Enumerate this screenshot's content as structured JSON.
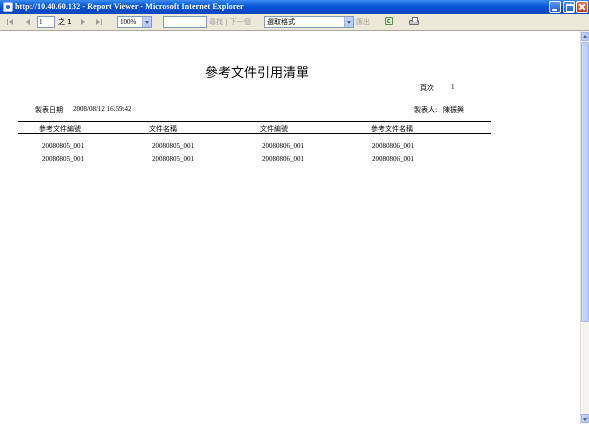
{
  "window": {
    "title": "http://10.40.60.132 - Report Viewer - Microsoft Internet Explorer"
  },
  "toolbar": {
    "page_number": "1",
    "of_total": "之 1",
    "zoom": "100%",
    "find_input_value": "",
    "find_links": "尋找 | 下一個",
    "export_format": "選取格式",
    "export_label": "匯出"
  },
  "report": {
    "title": "參考文件引用清單",
    "page_label": "頁次",
    "page_number": "1",
    "print_date_label": "製表日期",
    "print_date_value": "2008/08/12 16:59:42",
    "creator_label": "製表人:",
    "creator_value": "陳振興",
    "columns": [
      "參考文件編號",
      "文件名稱",
      "文件編號",
      "參考文件名稱"
    ],
    "rows": [
      [
        "20080805_001",
        "20080805_001",
        "20080806_001",
        "20080806_001"
      ],
      [
        "20080805_001",
        "20080805_001",
        "20080806_001",
        "20080806_001"
      ]
    ]
  },
  "colors": {
    "titlebar": "#0A5BD8",
    "toolbar_bg": "#ECE9D8",
    "report_bg": "#FFFFFF",
    "disabled_text": "#A0A0A0"
  },
  "icons": {
    "first_page": "first-page-icon",
    "prev_page": "prev-page-icon",
    "next_page": "next-page-icon",
    "last_page": "last-page-icon",
    "refresh": "refresh-icon",
    "print": "print-icon"
  }
}
